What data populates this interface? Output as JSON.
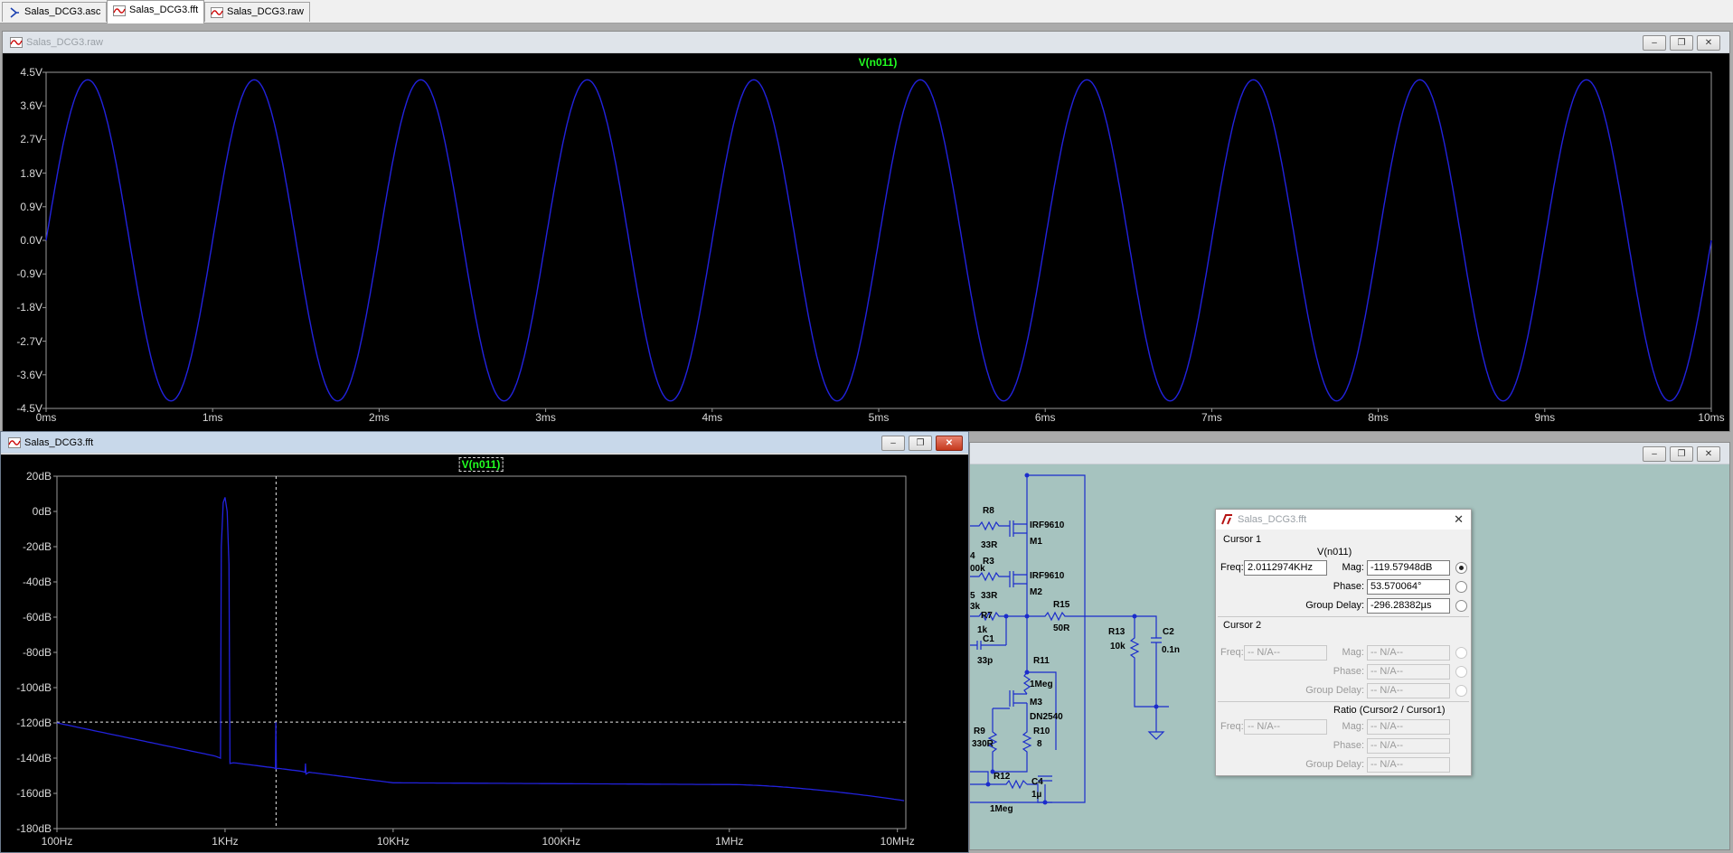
{
  "tabs": [
    {
      "label": "Salas_DCG3.asc",
      "icon": "schematic-icon",
      "active": false
    },
    {
      "label": "Salas_DCG3.fft",
      "icon": "waveform-icon",
      "active": true
    },
    {
      "label": "Salas_DCG3.raw",
      "icon": "waveform-icon",
      "active": false
    }
  ],
  "raw_window": {
    "title": "Salas_DCG3.raw",
    "trace": "V(n011)",
    "trace_color": "#2222dd",
    "y_ticks": [
      "4.5V",
      "3.6V",
      "2.7V",
      "1.8V",
      "0.9V",
      "0.0V",
      "-0.9V",
      "-1.8V",
      "-2.7V",
      "-3.6V",
      "-4.5V"
    ],
    "x_ticks": [
      "0ms",
      "1ms",
      "2ms",
      "3ms",
      "4ms",
      "5ms",
      "6ms",
      "7ms",
      "8ms",
      "9ms",
      "10ms"
    ]
  },
  "fft_window": {
    "title": "Salas_DCG3.fft",
    "trace": "V(n011)",
    "y_ticks": [
      "20dB",
      "0dB",
      "-20dB",
      "-40dB",
      "-60dB",
      "-80dB",
      "-100dB",
      "-120dB",
      "-140dB",
      "-160dB",
      "-180dB"
    ],
    "x_ticks": [
      "100Hz",
      "1KHz",
      "10KHz",
      "100KHz",
      "1MHz",
      "10MHz"
    ]
  },
  "schematic": {
    "labels": [
      {
        "id": "r8",
        "text": "R8"
      },
      {
        "id": "r8v",
        "text": "33R"
      },
      {
        "id": "m1t",
        "text": "IRF9610"
      },
      {
        "id": "m1",
        "text": "M1"
      },
      {
        "id": "n4",
        "text": "4"
      },
      {
        "id": "n00k",
        "text": "00k"
      },
      {
        "id": "r3",
        "text": "R3"
      },
      {
        "id": "r3v",
        "text": "33R"
      },
      {
        "id": "m2t",
        "text": "IRF9610"
      },
      {
        "id": "m2",
        "text": "M2"
      },
      {
        "id": "n5",
        "text": "5"
      },
      {
        "id": "n3k",
        "text": "3k"
      },
      {
        "id": "r7",
        "text": "R7"
      },
      {
        "id": "r15",
        "text": "R15"
      },
      {
        "id": "r15v",
        "text": "50R"
      },
      {
        "id": "r7v",
        "text": "1k"
      },
      {
        "id": "c1",
        "text": "C1"
      },
      {
        "id": "c1v",
        "text": "33p"
      },
      {
        "id": "r13",
        "text": "R13"
      },
      {
        "id": "r13v",
        "text": "10k"
      },
      {
        "id": "c2",
        "text": "C2"
      },
      {
        "id": "c2v",
        "text": "0.1n"
      },
      {
        "id": "r11",
        "text": "R11"
      },
      {
        "id": "r11v",
        "text": "1Meg"
      },
      {
        "id": "m3",
        "text": "M3"
      },
      {
        "id": "m3t",
        "text": "DN2540"
      },
      {
        "id": "r9",
        "text": "R9"
      },
      {
        "id": "r9v",
        "text": "330R"
      },
      {
        "id": "r10",
        "text": "R10"
      },
      {
        "id": "r10v",
        "text": "8"
      },
      {
        "id": "r12",
        "text": "R12"
      },
      {
        "id": "r12v",
        "text": "1Meg"
      },
      {
        "id": "c4",
        "text": "C4"
      },
      {
        "id": "c4v",
        "text": "1µ"
      }
    ]
  },
  "cursor_dialog": {
    "title": "Salas_DCG3.fft",
    "cursor1": {
      "header": "Cursor 1",
      "trace": "V(n011)",
      "freq_label": "Freq:",
      "freq": "2.0112974KHz",
      "mag_label": "Mag:",
      "mag": "-119.57948dB",
      "phase_label": "Phase:",
      "phase": "53.570064°",
      "gd_label": "Group Delay:",
      "gd": "-296.28382µs"
    },
    "cursor2": {
      "header": "Cursor 2",
      "freq_label": "Freq:",
      "freq": "-- N/A--",
      "mag_label": "Mag:",
      "mag": "-- N/A--",
      "phase_label": "Phase:",
      "phase": "-- N/A--",
      "gd_label": "Group Delay:",
      "gd": "-- N/A--"
    },
    "ratio": {
      "header": "Ratio (Cursor2 / Cursor1)",
      "freq_label": "Freq:",
      "freq": "-- N/A--",
      "mag_label": "Mag:",
      "mag": "-- N/A--",
      "phase_label": "Phase:",
      "phase": "-- N/A--",
      "gd_label": "Group Delay:",
      "gd": "-- N/A--"
    }
  },
  "window_buttons": {
    "minimize": "–",
    "restore": "❐",
    "close": "✕"
  }
}
